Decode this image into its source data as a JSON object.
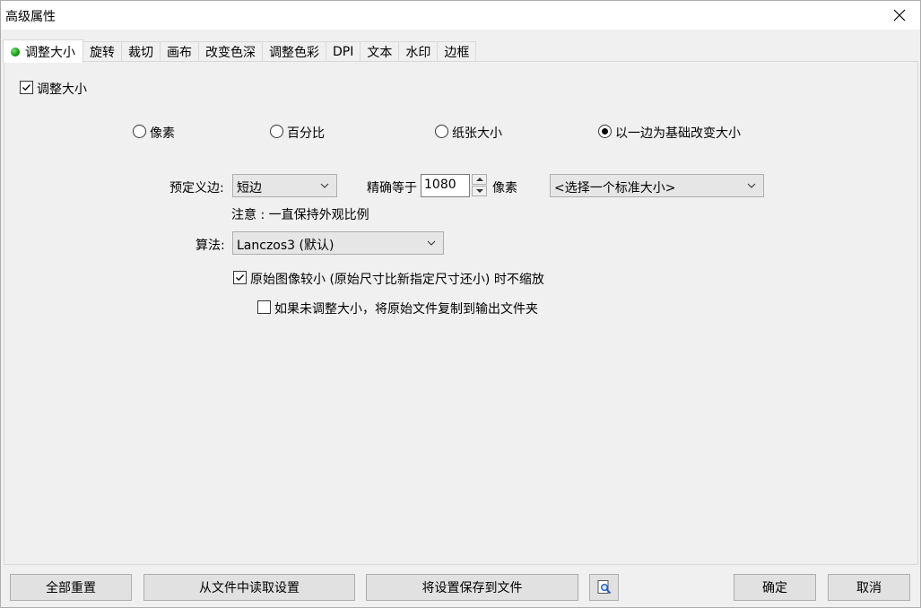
{
  "window": {
    "title": "高级属性",
    "close_icon": "close-icon"
  },
  "tabs": [
    {
      "label": "调整大小",
      "active": true,
      "icon": "green-dot-icon"
    },
    {
      "label": "旋转"
    },
    {
      "label": "裁切"
    },
    {
      "label": "画布"
    },
    {
      "label": "改变色深"
    },
    {
      "label": "调整色彩"
    },
    {
      "label": "DPI"
    },
    {
      "label": "文本"
    },
    {
      "label": "水印"
    },
    {
      "label": "边框"
    }
  ],
  "resize": {
    "enable_label": "调整大小",
    "enable_checked": true,
    "modes": [
      {
        "label": "像素",
        "checked": false
      },
      {
        "label": "百分比",
        "checked": false
      },
      {
        "label": "纸张大小",
        "checked": false
      },
      {
        "label": "以一边为基础改变大小",
        "checked": true
      }
    ],
    "predefined_side_label": "预定义边:",
    "predefined_side_value": "短边",
    "exact_label": "精确等于",
    "exact_value": "1080",
    "unit_label": "像素",
    "standard_size_value": "<选择一个标准大小>",
    "note": "注意 : 一直保持外观比例",
    "algorithm_label": "算法:",
    "algorithm_value": "Lanczos3 (默认)",
    "no_upscale_label": "原始图像较小 (原始尺寸比新指定尺寸还小) 时不缩放",
    "no_upscale_checked": true,
    "copy_original_label": "如果未调整大小，将原始文件复制到输出文件夹",
    "copy_original_checked": false
  },
  "footer": {
    "reset_all": "全部重置",
    "load_from_file": "从文件中读取设置",
    "save_to_file": "将设置保存到文件",
    "preview_icon": "magnifier-preview-icon",
    "ok": "确定",
    "cancel": "取消"
  }
}
